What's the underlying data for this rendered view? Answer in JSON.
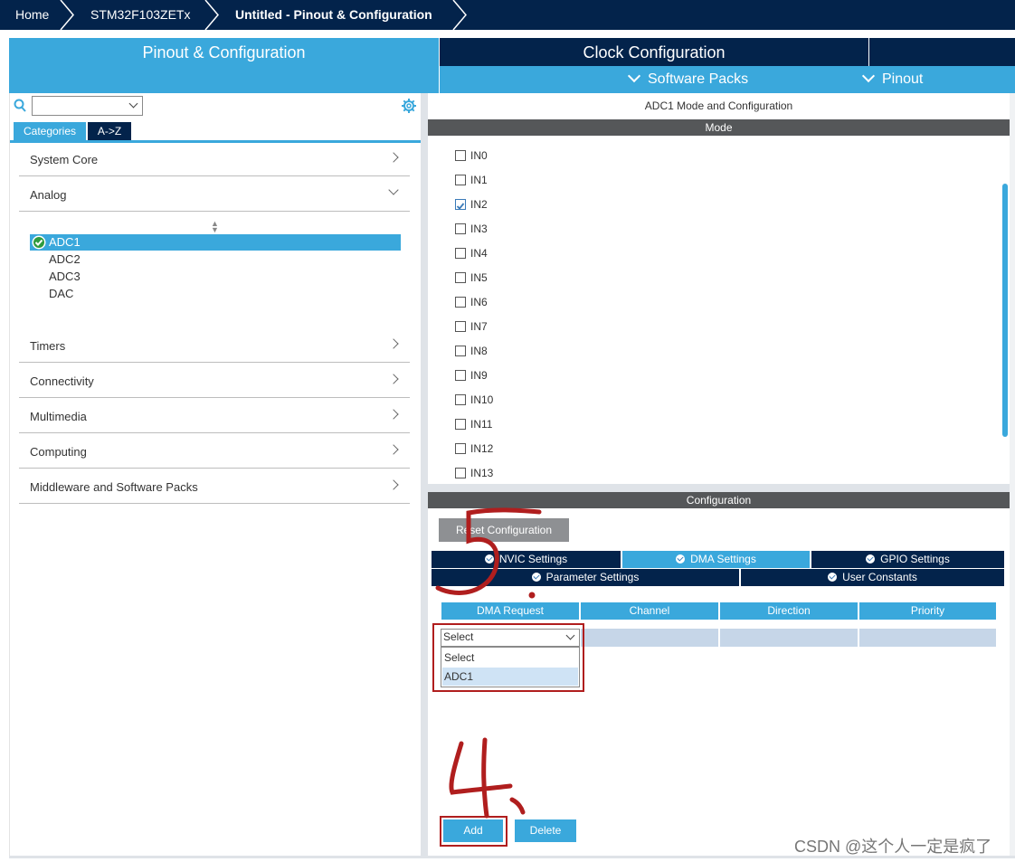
{
  "breadcrumb": {
    "items": [
      "Home",
      "STM32F103ZETx",
      "Untitled - Pinout & Configuration"
    ]
  },
  "tabs": {
    "pinout": "Pinout & Configuration",
    "clock": "Clock Configuration",
    "software_packs": "Software Packs",
    "pinout_menu": "Pinout"
  },
  "left": {
    "search_value": "",
    "view_tabs": [
      "Categories",
      "A->Z"
    ],
    "categories": [
      {
        "label": "System Core",
        "expanded": false
      },
      {
        "label": "Analog",
        "expanded": true
      },
      {
        "label": "Timers",
        "expanded": false
      },
      {
        "label": "Connectivity",
        "expanded": false
      },
      {
        "label": "Multimedia",
        "expanded": false
      },
      {
        "label": "Computing",
        "expanded": false
      },
      {
        "label": "Middleware and Software Packs",
        "expanded": false
      }
    ],
    "analog_items": [
      {
        "label": "ADC1",
        "selected": true,
        "enabled": true
      },
      {
        "label": "ADC2",
        "selected": false,
        "enabled": false
      },
      {
        "label": "ADC3",
        "selected": false,
        "enabled": false
      },
      {
        "label": "DAC",
        "selected": false,
        "enabled": false
      }
    ]
  },
  "right": {
    "title": "ADC1 Mode and Configuration",
    "mode_header": "Mode",
    "mode_items": [
      {
        "label": "IN0",
        "checked": false
      },
      {
        "label": "IN1",
        "checked": false
      },
      {
        "label": "IN2",
        "checked": true
      },
      {
        "label": "IN3",
        "checked": false
      },
      {
        "label": "IN4",
        "checked": false
      },
      {
        "label": "IN5",
        "checked": false
      },
      {
        "label": "IN6",
        "checked": false
      },
      {
        "label": "IN7",
        "checked": false
      },
      {
        "label": "IN8",
        "checked": false
      },
      {
        "label": "IN9",
        "checked": false
      },
      {
        "label": "IN10",
        "checked": false
      },
      {
        "label": "IN11",
        "checked": false
      },
      {
        "label": "IN12",
        "checked": false
      },
      {
        "label": "IN13",
        "checked": false
      }
    ],
    "config_header": "Configuration",
    "reset_label": "Reset Configuration",
    "settings_tabs_row1": [
      "NVIC Settings",
      "DMA Settings",
      "GPIO Settings"
    ],
    "settings_tabs_row2": [
      "Parameter Settings",
      "User Constants"
    ],
    "active_tab": "DMA Settings",
    "dma_columns": [
      "DMA Request",
      "Channel",
      "Direction",
      "Priority"
    ],
    "dma_select_value": "Select",
    "dma_options": [
      "Select",
      "ADC1"
    ],
    "add_label": "Add",
    "delete_label": "Delete"
  },
  "annotations": {
    "step_a": "5.",
    "step_b": "4."
  },
  "watermark": "CSDN @这个人一定是疯了",
  "colors": {
    "navy": "#03234b",
    "accent": "#3aa8dc",
    "header_grey": "#555759",
    "annotation_red": "#b01e1e"
  }
}
